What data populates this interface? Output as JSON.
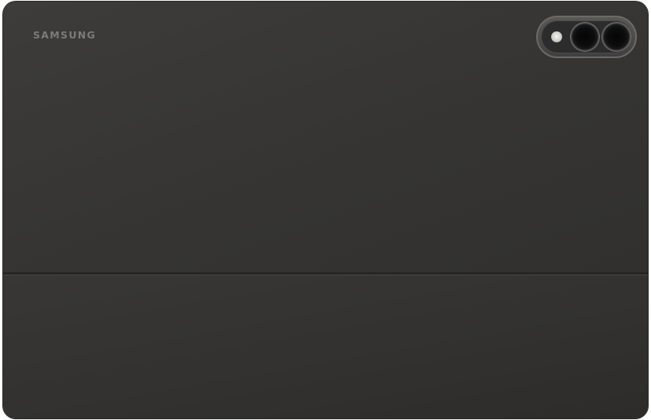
{
  "product": {
    "brand_logo": "SAMSUNG"
  },
  "colors": {
    "case_body": "#363533",
    "logo_text": "#7c7b78",
    "camera_bump": "#5a5957",
    "background": "#ffffff"
  },
  "icons": [
    "camera-flash-icon",
    "camera-lens-icon",
    "camera-lens-icon"
  ]
}
